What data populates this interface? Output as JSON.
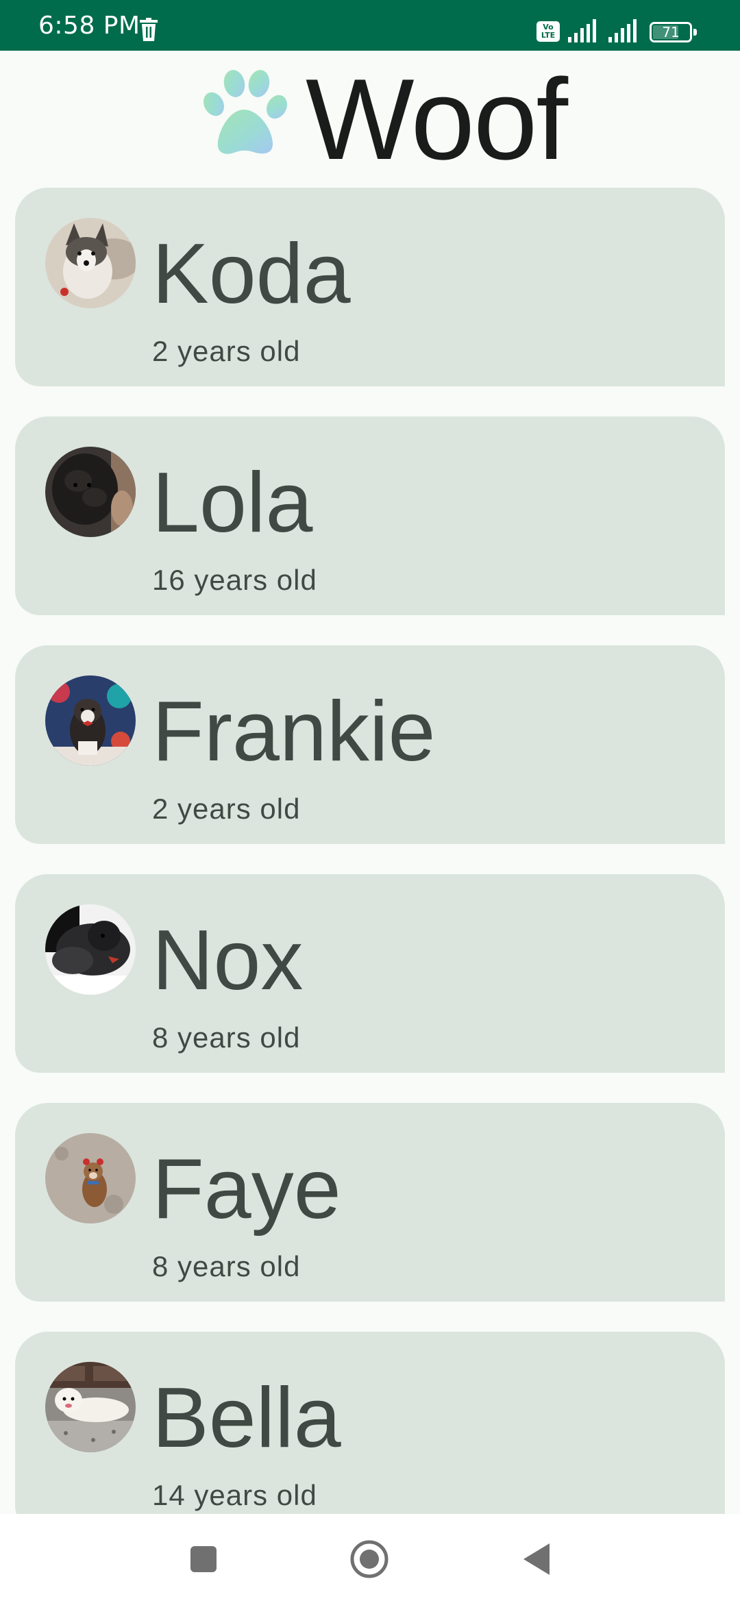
{
  "status_bar": {
    "time": "6:58 PM",
    "volte": "Vo\nLTE",
    "battery": "71",
    "battery_level": 0.71,
    "icons": [
      "trash-icon",
      "volte-icon",
      "signal-icon",
      "signal-icon",
      "battery-icon"
    ]
  },
  "app_bar": {
    "title": "Woof",
    "logo_icon": "paw-icon"
  },
  "dogs": [
    {
      "name": "Koda",
      "age": "2 years old"
    },
    {
      "name": "Lola",
      "age": "16 years old"
    },
    {
      "name": "Frankie",
      "age": "2 years old"
    },
    {
      "name": "Nox",
      "age": "8 years old"
    },
    {
      "name": "Faye",
      "age": "8 years old"
    },
    {
      "name": "Bella",
      "age": "14 years old"
    }
  ],
  "nav_bar": {
    "icons": [
      "recent-apps-icon",
      "home-icon",
      "back-icon"
    ]
  },
  "colors": {
    "status_bar": "#006C4B",
    "background": "#F8FBF7",
    "card": "#DBE5DE",
    "card_text": "#404943",
    "title_text": "#191C1A"
  }
}
